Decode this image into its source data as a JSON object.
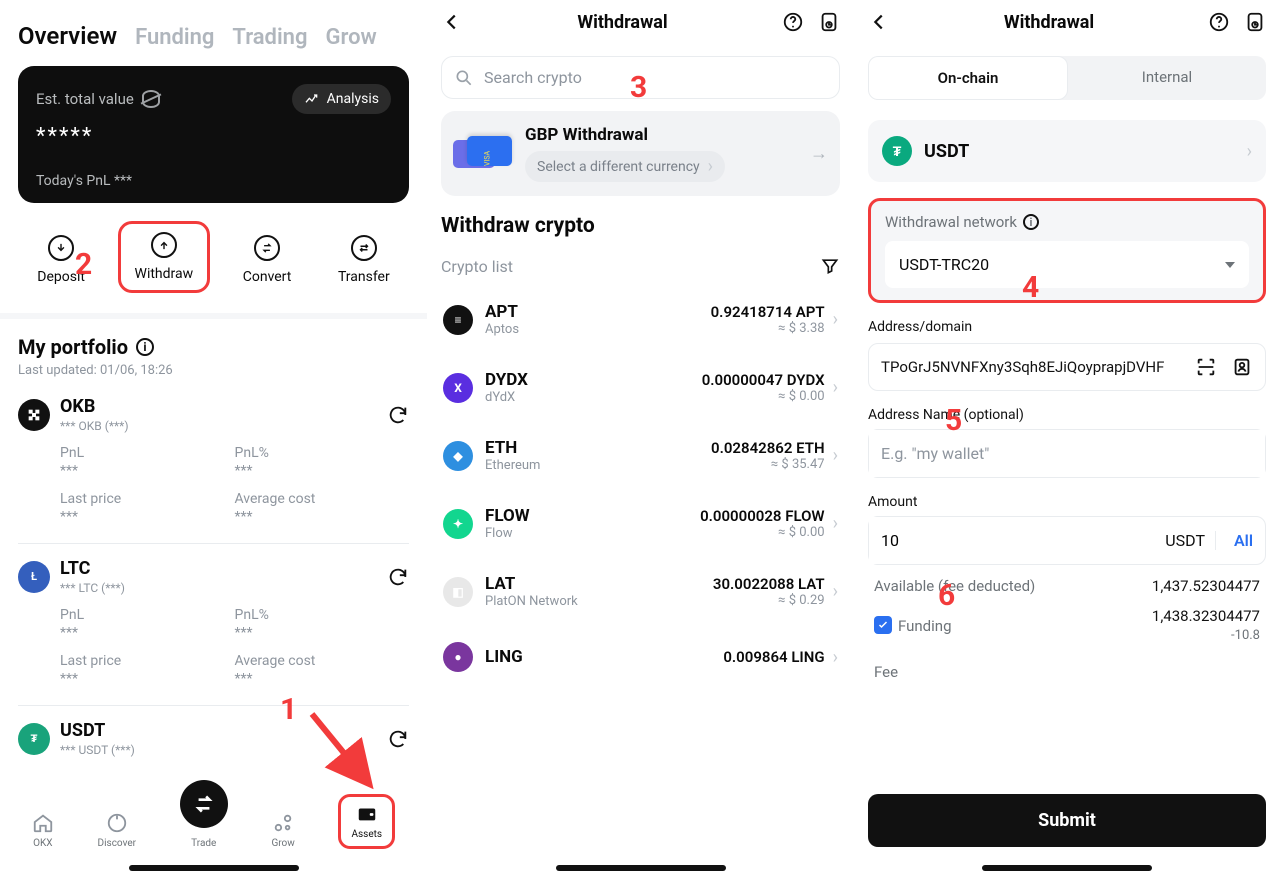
{
  "colors": {
    "accent": "#f23b3b",
    "blue": "#2a6ff0",
    "green": "#07b07b"
  },
  "overview": {
    "tabs": [
      "Overview",
      "Funding",
      "Trading",
      "Grow"
    ],
    "active_tab": 0,
    "card": {
      "est_label": "Est. total value",
      "value_masked": "*****",
      "analysis_label": "Analysis",
      "today_pnl_label": "Today's PnL",
      "today_pnl_value": "***"
    },
    "actions": [
      {
        "id": "deposit",
        "label": "Deposit"
      },
      {
        "id": "withdraw",
        "label": "Withdraw"
      },
      {
        "id": "convert",
        "label": "Convert"
      },
      {
        "id": "transfer",
        "label": "Transfer"
      }
    ],
    "portfolio": {
      "title": "My portfolio",
      "updated": "Last updated: 01/06, 18:26",
      "cols": {
        "pnl": "PnL",
        "pnlp": "PnL%",
        "last": "Last price",
        "avg": "Average cost"
      },
      "assets": [
        {
          "sym": "OKB",
          "sub": "*** OKB (***)",
          "class": "okb",
          "vals": {
            "pnl": "***",
            "pnlp": "***",
            "last": "***",
            "avg": "***"
          }
        },
        {
          "sym": "LTC",
          "sub": "*** LTC  (***)",
          "class": "ltc",
          "vals": {
            "pnl": "***",
            "pnlp": "***",
            "last": "***",
            "avg": "***"
          }
        },
        {
          "sym": "USDT",
          "sub": "*** USDT (***)",
          "class": "usdt"
        }
      ]
    },
    "tabbar": [
      {
        "id": "okx",
        "label": "OKX"
      },
      {
        "id": "discover",
        "label": "Discover"
      },
      {
        "id": "trade",
        "label": "Trade"
      },
      {
        "id": "grow",
        "label": "Grow"
      },
      {
        "id": "assets",
        "label": "Assets"
      }
    ]
  },
  "withdraw_list": {
    "title": "Withdrawal",
    "search_placeholder": "Search crypto",
    "gbp": {
      "title": "GBP Withdrawal",
      "sub": "Select a different currency"
    },
    "section_title": "Withdraw crypto",
    "list_label": "Crypto list",
    "items": [
      {
        "sym": "APT",
        "name": "Aptos",
        "qty": "0.92418714 APT",
        "fiat": "≈ $ 3.38",
        "cls": "cAPT"
      },
      {
        "sym": "DYDX",
        "name": "dYdX",
        "qty": "0.00000047 DYDX",
        "fiat": "≈ $ 0.00",
        "cls": "cDYDX"
      },
      {
        "sym": "ETH",
        "name": "Ethereum",
        "qty": "0.02842862 ETH",
        "fiat": "≈ $ 35.47",
        "cls": "cETH"
      },
      {
        "sym": "FLOW",
        "name": "Flow",
        "qty": "0.00000028 FLOW",
        "fiat": "≈ $ 0.00",
        "cls": "cFLOW"
      },
      {
        "sym": "LAT",
        "name": "PlatON Network",
        "qty": "30.0022088 LAT",
        "fiat": "≈ $ 0.29",
        "cls": "cLAT"
      },
      {
        "sym": "LING",
        "name": "",
        "qty": "0.009864 LING",
        "fiat": "",
        "cls": "cLING"
      }
    ]
  },
  "withdraw_form": {
    "title": "Withdrawal",
    "seg_onchain": "On-chain",
    "seg_internal": "Internal",
    "asset": "USDT",
    "network_label": "Withdrawal network",
    "network_value": "USDT-TRC20",
    "addr_label": "Address/domain",
    "addr_value": "TPoGrJ5NVNFXny3Sqh8EJiQoyprapjDVHF",
    "addr_name_label": "Address Name (optional)",
    "addr_name_placeholder": "E.g. \"my wallet\"",
    "amount_label": "Amount",
    "amount_value": "10",
    "amount_unit": "USDT",
    "amount_all": "All",
    "available_label": "Available (fee deducted)",
    "available_value": "1,437.52304477",
    "funding_label": "Funding",
    "funding_value": "1,438.32304477",
    "funding_fee": "-10.8",
    "fee_label": "Fee",
    "submit": "Submit"
  },
  "annotations": {
    "n1": "1",
    "n2": "2",
    "n3": "3",
    "n4": "4",
    "n5": "5",
    "n6": "6"
  }
}
